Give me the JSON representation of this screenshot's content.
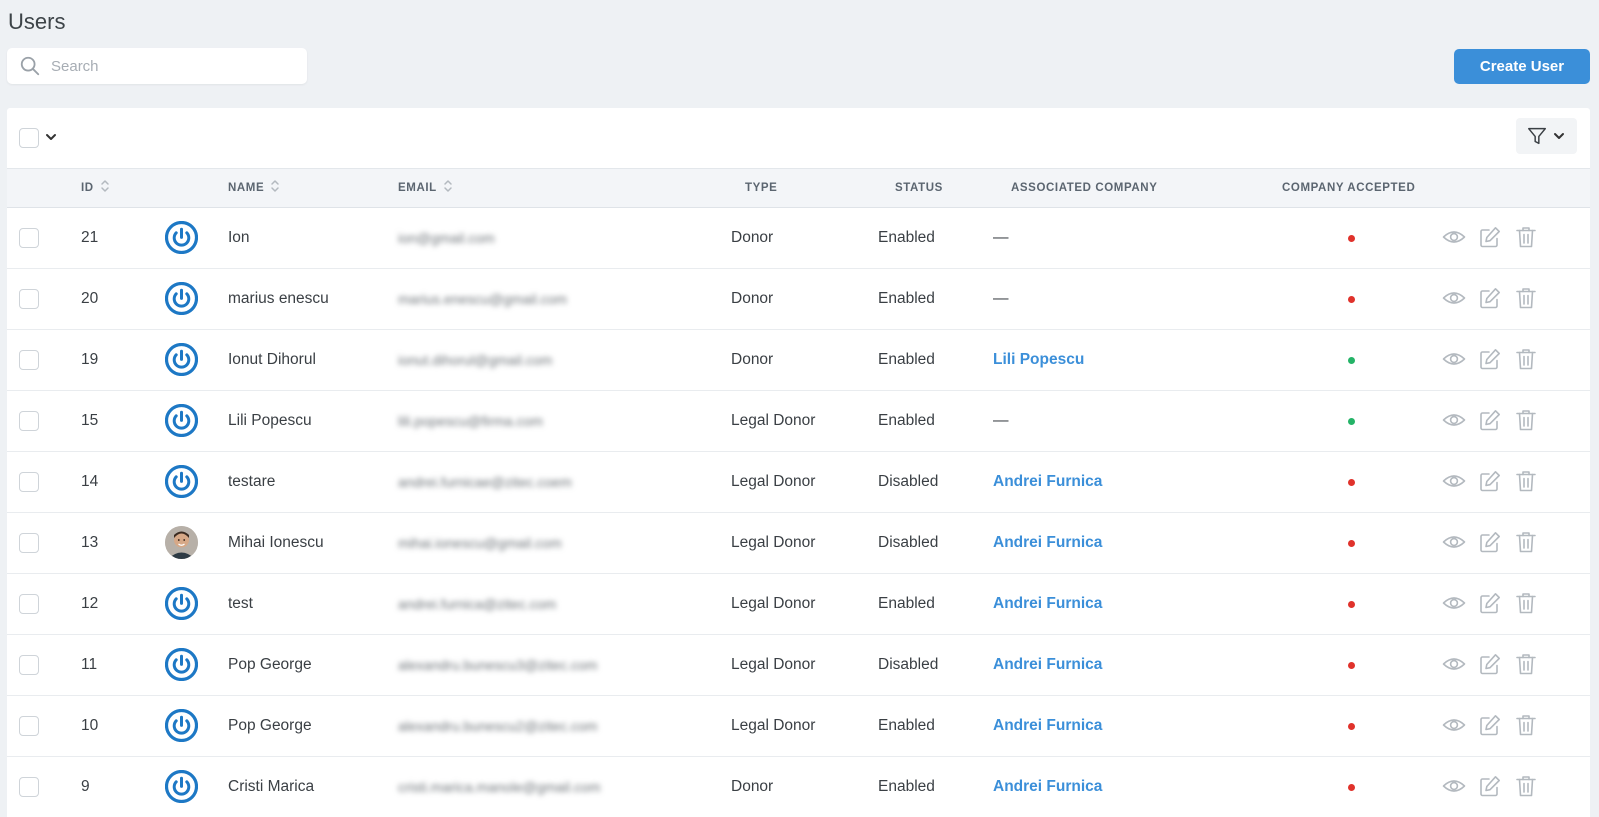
{
  "page": {
    "title": "Users"
  },
  "search": {
    "placeholder": "Search",
    "value": ""
  },
  "header": {
    "create_label": "Create User"
  },
  "colors": {
    "accent": "#3b8fd9",
    "status_red": "#e0322b",
    "status_green": "#24b367"
  },
  "table": {
    "columns": {
      "id": "ID",
      "name": "NAME",
      "email": "EMAIL",
      "type": "TYPE",
      "status": "STATUS",
      "company": "ASSOCIATED COMPANY",
      "accepted": "COMPANY ACCEPTED"
    },
    "rows": [
      {
        "id": "21",
        "avatar": "power-icon",
        "name": "Ion",
        "email": "ion@gmail.com",
        "type": "Donor",
        "status": "Enabled",
        "company": "—",
        "company_is_link": false,
        "accepted": "red"
      },
      {
        "id": "20",
        "avatar": "power-icon",
        "name": "marius enescu",
        "email": "marius.enescu@gmail.com",
        "type": "Donor",
        "status": "Enabled",
        "company": "—",
        "company_is_link": false,
        "accepted": "red"
      },
      {
        "id": "19",
        "avatar": "power-icon",
        "name": "Ionut Dihorul",
        "email": "ionut.dihorul@gmail.com",
        "type": "Donor",
        "status": "Enabled",
        "company": "Lili Popescu",
        "company_is_link": true,
        "accepted": "green"
      },
      {
        "id": "15",
        "avatar": "power-icon",
        "name": "Lili Popescu",
        "email": "lili.popescu@firma.com",
        "type": "Legal Donor",
        "status": "Enabled",
        "company": "—",
        "company_is_link": false,
        "accepted": "green"
      },
      {
        "id": "14",
        "avatar": "power-icon",
        "name": "testare",
        "email": "andrei.furnicae@zitec.coem",
        "type": "Legal Donor",
        "status": "Disabled",
        "company": "Andrei Furnica",
        "company_is_link": true,
        "accepted": "red"
      },
      {
        "id": "13",
        "avatar": "photo",
        "name": "Mihai Ionescu",
        "email": "mihai.ionescu@gmail.com",
        "type": "Legal Donor",
        "status": "Disabled",
        "company": "Andrei Furnica",
        "company_is_link": true,
        "accepted": "red"
      },
      {
        "id": "12",
        "avatar": "power-icon",
        "name": "test",
        "email": "andrei.furnica@zitec.com",
        "type": "Legal Donor",
        "status": "Enabled",
        "company": "Andrei Furnica",
        "company_is_link": true,
        "accepted": "red"
      },
      {
        "id": "11",
        "avatar": "power-icon",
        "name": "Pop George",
        "email": "alexandru.bunescu3@zitec.com",
        "type": "Legal Donor",
        "status": "Disabled",
        "company": "Andrei Furnica",
        "company_is_link": true,
        "accepted": "red"
      },
      {
        "id": "10",
        "avatar": "power-icon",
        "name": "Pop George",
        "email": "alexandru.bunescu2@zitec.com",
        "type": "Legal Donor",
        "status": "Enabled",
        "company": "Andrei Furnica",
        "company_is_link": true,
        "accepted": "red"
      },
      {
        "id": "9",
        "avatar": "power-icon",
        "name": "Cristi Marica",
        "email": "cristi.marica.manole@gmail.com",
        "type": "Donor",
        "status": "Enabled",
        "company": "Andrei Furnica",
        "company_is_link": true,
        "accepted": "red"
      }
    ],
    "row_actions": [
      "eye-icon",
      "edit-icon",
      "trash-icon"
    ]
  }
}
